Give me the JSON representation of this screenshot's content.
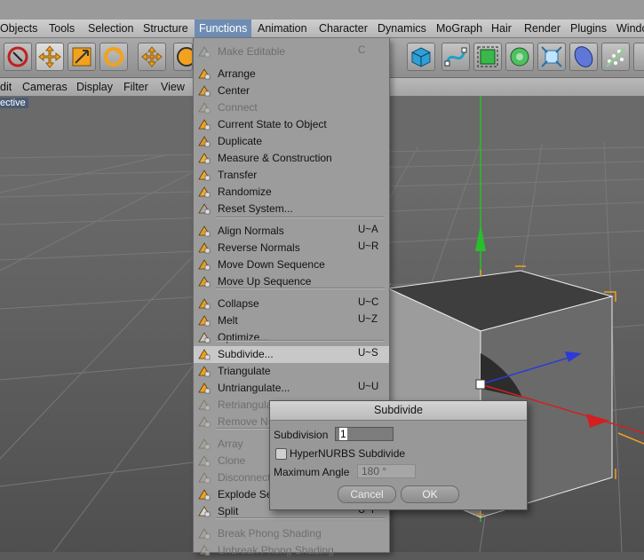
{
  "menubar": {
    "items": [
      "Objects",
      "Tools",
      "Selection",
      "Structure",
      "Functions",
      "Animation",
      "Character",
      "Dynamics",
      "MoGraph",
      "Hair",
      "Render",
      "Plugins",
      "Windo"
    ],
    "active": "Functions"
  },
  "viewport_menu": {
    "items": [
      "dit",
      "Cameras",
      "Display",
      "Filter",
      "View"
    ],
    "label": "ective"
  },
  "functions_menu": {
    "items": [
      {
        "label": "Make Editable",
        "shortcut": "C",
        "disabled": true,
        "icon": "make-editable-icon"
      },
      {
        "label": "Arrange",
        "shortcut": "",
        "disabled": false,
        "icon": "arrange-icon"
      },
      {
        "label": "Center",
        "shortcut": "",
        "disabled": false,
        "icon": "center-icon"
      },
      {
        "label": "Connect",
        "shortcut": "",
        "disabled": true,
        "icon": "connect-icon"
      },
      {
        "label": "Current State to Object",
        "shortcut": "",
        "disabled": false,
        "icon": "current-state-icon"
      },
      {
        "label": "Duplicate",
        "shortcut": "",
        "disabled": false,
        "icon": "duplicate-icon"
      },
      {
        "label": "Measure & Construction",
        "shortcut": "",
        "disabled": false,
        "icon": "measure-icon"
      },
      {
        "label": "Transfer",
        "shortcut": "",
        "disabled": false,
        "icon": "transfer-icon"
      },
      {
        "label": "Randomize",
        "shortcut": "",
        "disabled": false,
        "icon": "randomize-icon"
      },
      {
        "label": "Reset System...",
        "shortcut": "",
        "disabled": false,
        "icon": "reset-system-icon"
      },
      {
        "label": "Align Normals",
        "shortcut": "U~A",
        "disabled": false,
        "icon": "align-normals-icon"
      },
      {
        "label": "Reverse Normals",
        "shortcut": "U~R",
        "disabled": false,
        "icon": "reverse-normals-icon"
      },
      {
        "label": "Move Down Sequence",
        "shortcut": "",
        "disabled": false,
        "icon": "move-down-icon"
      },
      {
        "label": "Move Up Sequence",
        "shortcut": "",
        "disabled": false,
        "icon": "move-up-icon"
      },
      {
        "label": "Collapse",
        "shortcut": "U~C",
        "disabled": false,
        "icon": "collapse-icon"
      },
      {
        "label": "Melt",
        "shortcut": "U~Z",
        "disabled": false,
        "icon": "melt-icon"
      },
      {
        "label": "Optimize...",
        "shortcut": "",
        "disabled": false,
        "icon": "optimize-icon"
      },
      {
        "label": "Subdivide...",
        "shortcut": "U~S",
        "disabled": false,
        "icon": "subdivide-icon"
      },
      {
        "label": "Triangulate",
        "shortcut": "",
        "disabled": false,
        "icon": "triangulate-icon"
      },
      {
        "label": "Untriangulate...",
        "shortcut": "U~U",
        "disabled": false,
        "icon": "untriangulate-icon"
      },
      {
        "label": "Retriangula",
        "shortcut": "",
        "disabled": true,
        "icon": "retriangulate-icon"
      },
      {
        "label": "Remove N-",
        "shortcut": "",
        "disabled": true,
        "icon": "remove-ngons-icon"
      },
      {
        "label": "Array",
        "shortcut": "",
        "disabled": true,
        "icon": "array-icon"
      },
      {
        "label": "Clone",
        "shortcut": "",
        "disabled": true,
        "icon": "clone-icon"
      },
      {
        "label": "Disconnect",
        "shortcut": "",
        "disabled": true,
        "icon": "disconnect-icon"
      },
      {
        "label": "Explode Se",
        "shortcut": "",
        "disabled": false,
        "icon": "explode-icon"
      },
      {
        "label": "Split",
        "shortcut": "U~P",
        "disabled": false,
        "icon": "split-icon"
      },
      {
        "label": "Break Phong Shading",
        "shortcut": "",
        "disabled": true,
        "icon": "break-phong-icon"
      },
      {
        "label": "Unbreak Phong Shading",
        "shortcut": "",
        "disabled": true,
        "icon": "unbreak-phong-icon"
      }
    ],
    "highlighted": "Subdivide..."
  },
  "dialog": {
    "title": "Subdivide",
    "subdivision_label": "Subdivision",
    "subdivision_value": "1",
    "hypernurbs_label": "HyperNURBS Subdivide",
    "hypernurbs_checked": false,
    "max_angle_label": "Maximum Angle",
    "max_angle_value": "180 °",
    "cancel_label": "Cancel",
    "ok_label": "OK"
  },
  "colors": {
    "y_axis": "#27c02a",
    "x_axis": "#d22020",
    "z_axis": "#2c3ad8",
    "selection": "#f0a020",
    "menu_bg": "#9c9c9c"
  }
}
